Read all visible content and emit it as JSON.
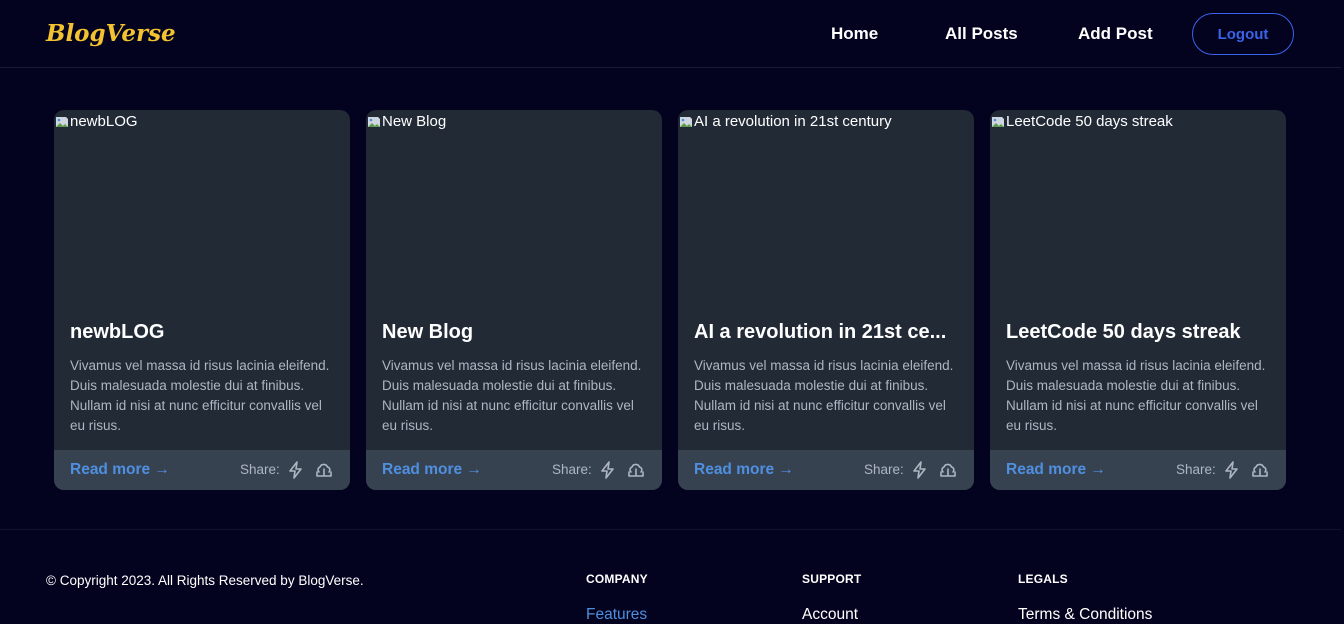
{
  "header": {
    "brand": "BlogVerse",
    "nav": [
      "Home",
      "All Posts",
      "Add Post"
    ],
    "logout_label": "Logout"
  },
  "posts": [
    {
      "image_alt": "newbLOG",
      "title": "newbLOG",
      "excerpt": "Vivamus vel massa id risus lacinia eleifend. Duis malesuada molestie dui at finibus. Nullam id nisi at nunc efficitur convallis vel eu risus.",
      "read_more": "Read more →",
      "share_label": "Share:"
    },
    {
      "image_alt": "New Blog",
      "title": "New Blog",
      "excerpt": "Vivamus vel massa id risus lacinia eleifend. Duis malesuada molestie dui at finibus. Nullam id nisi at nunc efficitur convallis vel eu risus.",
      "read_more": "Read more →",
      "share_label": "Share:"
    },
    {
      "image_alt": "AI a revolution in 21st century",
      "title": "AI a revolution in 21st ce...",
      "excerpt": "Vivamus vel massa id risus lacinia eleifend. Duis malesuada molestie dui at finibus. Nullam id nisi at nunc efficitur convallis vel eu risus.",
      "read_more": "Read more →",
      "share_label": "Share:"
    },
    {
      "image_alt": "LeetCode 50 days streak",
      "title": "LeetCode 50 days streak",
      "excerpt": "Vivamus vel massa id risus lacinia eleifend. Duis malesuada molestie dui at finibus. Nullam id nisi at nunc efficitur convallis vel eu risus.",
      "read_more": "Read more →",
      "share_label": "Share:"
    }
  ],
  "share_icons": [
    "lightning-icon",
    "cloud-upload-icon"
  ],
  "footer": {
    "copyright": "© Copyright 2023. All Rights Reserved by BlogVerse.",
    "columns": [
      {
        "heading": "COMPANY",
        "first_link": "Features"
      },
      {
        "heading": "SUPPORT",
        "first_link": "Account"
      },
      {
        "heading": "LEGALS",
        "first_link": "Terms & Conditions"
      }
    ]
  },
  "colors": {
    "background": "#03031f",
    "brand": "#f2c230",
    "accent": "#3b63e8",
    "card": "#222a36",
    "card_footer": "#374251",
    "link": "#4f8fe0"
  }
}
